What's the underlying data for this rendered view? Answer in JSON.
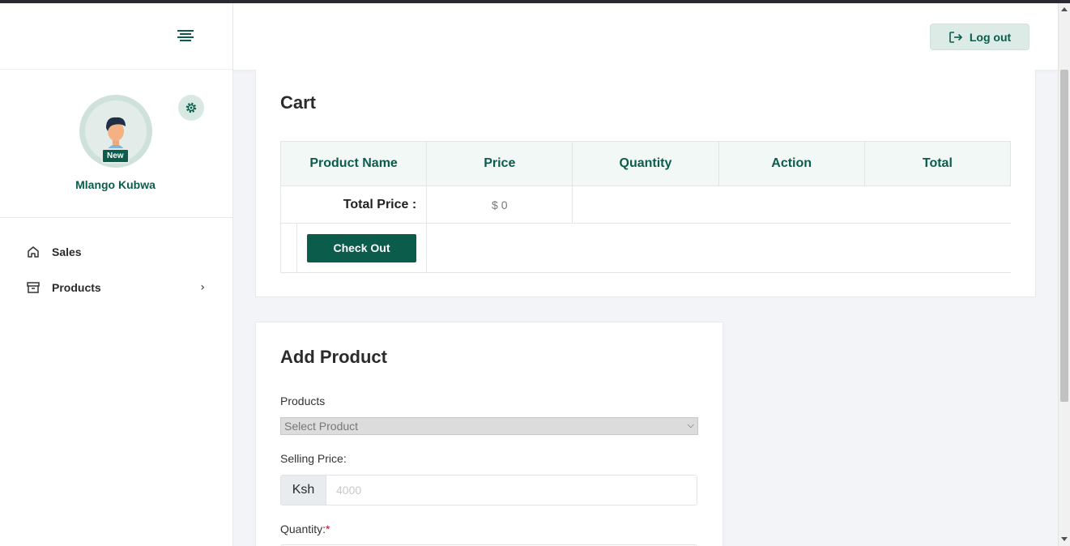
{
  "sidebar": {
    "user": {
      "name": "Mlango Kubwa",
      "badge": "New"
    },
    "nav": [
      {
        "label": "Sales",
        "icon": "home-icon"
      },
      {
        "label": "Products",
        "icon": "archive-icon",
        "chevron": "›"
      }
    ]
  },
  "header": {
    "logout_label": "Log out"
  },
  "cart": {
    "title": "Cart",
    "columns": [
      "Product Name",
      "Price",
      "Quantity",
      "Action",
      "Total"
    ],
    "total_label": "Total Price :",
    "total_value": "$ 0",
    "checkout_label": "Check Out"
  },
  "add_product": {
    "title": "Add Product",
    "products_label": "Products",
    "select_placeholder": "Select Product",
    "selling_price_label": "Selling Price:",
    "currency": "Ksh",
    "price_placeholder": "4000",
    "quantity_label": "Quantity:",
    "required_mark": "*"
  },
  "colors": {
    "brand": "#0b5c4b",
    "brand_light": "#dcebe6",
    "background": "#f2f4f8"
  }
}
